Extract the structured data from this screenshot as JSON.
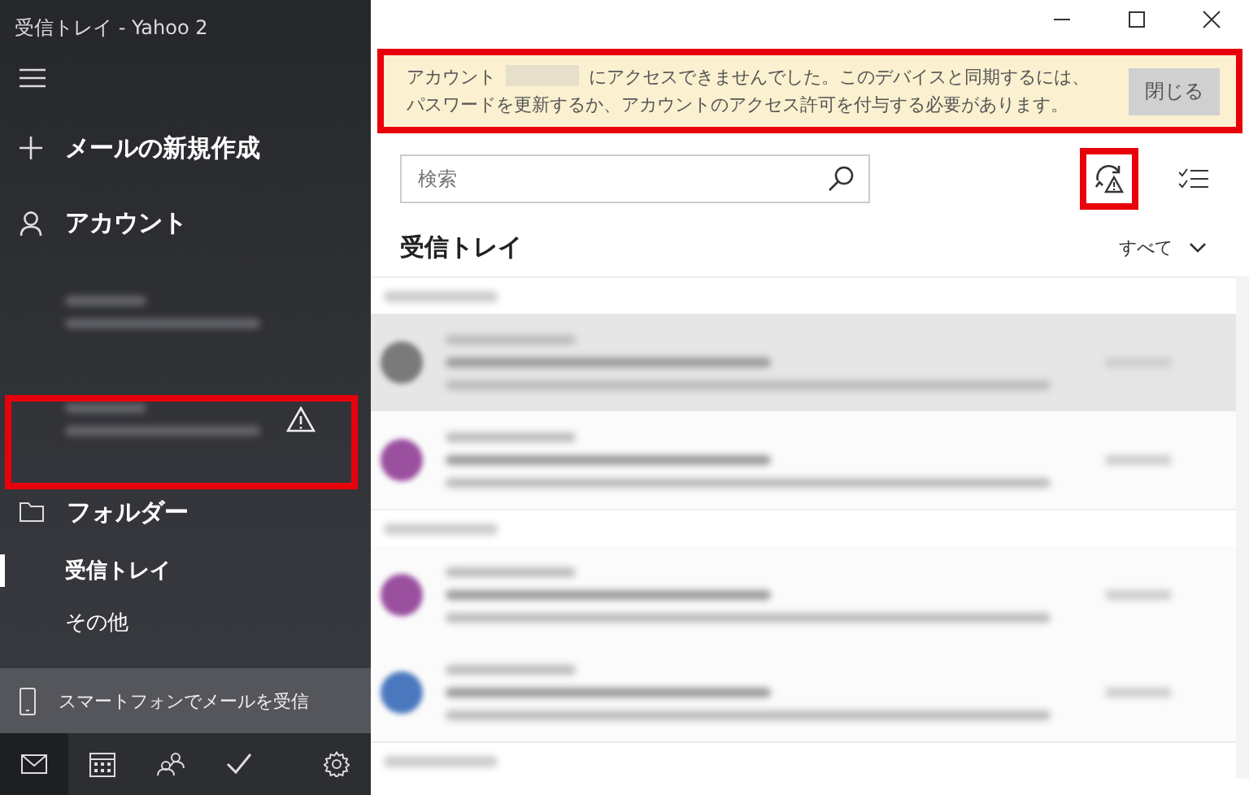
{
  "window": {
    "title": "受信トレイ - Yahoo 2"
  },
  "sidebar": {
    "new_mail": "メールの新規作成",
    "accounts_label": "アカウント",
    "accounts": [
      {
        "warning": false
      },
      {
        "warning": true
      }
    ],
    "folders_label": "フォルダー",
    "folders": [
      {
        "label": "受信トレイ",
        "selected": true
      },
      {
        "label": "その他",
        "selected": false
      }
    ],
    "promo": "スマートフォンでメールを受信",
    "bottom_nav": [
      {
        "kind": "mail",
        "selected": true
      },
      {
        "kind": "calendar",
        "selected": false
      },
      {
        "kind": "people",
        "selected": false
      },
      {
        "kind": "todo",
        "selected": false
      },
      {
        "kind": "settings",
        "selected": false
      }
    ]
  },
  "banner": {
    "message_before": "アカウント",
    "message_after": "にアクセスできませんでした。このデバイスと同期するには、パスワードを更新するか、アカウントのアクセス許可を付与する必要があります。",
    "button": "閉じる"
  },
  "search": {
    "placeholder": "検索"
  },
  "folder_title": "受信トレイ",
  "filter": "すべて",
  "messages": [
    {
      "kind": "header"
    },
    {
      "kind": "message",
      "color": "#7a7a7a",
      "selected": true
    },
    {
      "kind": "message",
      "color": "#9b4f9f",
      "selected": false
    },
    {
      "kind": "header"
    },
    {
      "kind": "message",
      "color": "#9b4f9f",
      "selected": false
    },
    {
      "kind": "message",
      "color": "#4a78bf",
      "selected": false
    },
    {
      "kind": "header"
    }
  ]
}
